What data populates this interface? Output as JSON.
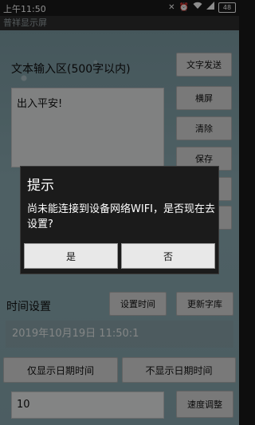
{
  "status_bar": {
    "time": "上午11:50",
    "icons": [
      "close-icon",
      "alarm-icon",
      "wifi-icon",
      "signal-icon",
      "battery-icon"
    ],
    "battery": "48"
  },
  "app_bar": {
    "title": "普祥显示屏"
  },
  "main": {
    "input_label": "文本输入区(500字以内)",
    "input_text": "出入平安!",
    "buttons": {
      "send_text": "文字发送",
      "landscape": "横屏",
      "clear": "清除",
      "save": "保存"
    },
    "time_settings_label": "时间设置",
    "set_time": "设置时间",
    "update_font": "更新字库",
    "date_value": "2019年10月19日  11:50:1",
    "show_date_only": "仅显示日期时间",
    "hide_date": "不显示日期时间",
    "speed_value": "10",
    "speed_adjust": "速度调整"
  },
  "dialog": {
    "title": "提示",
    "message": "尚未能连接到设备网络WIFI，是否现在去设置?",
    "yes": "是",
    "no": "否"
  }
}
